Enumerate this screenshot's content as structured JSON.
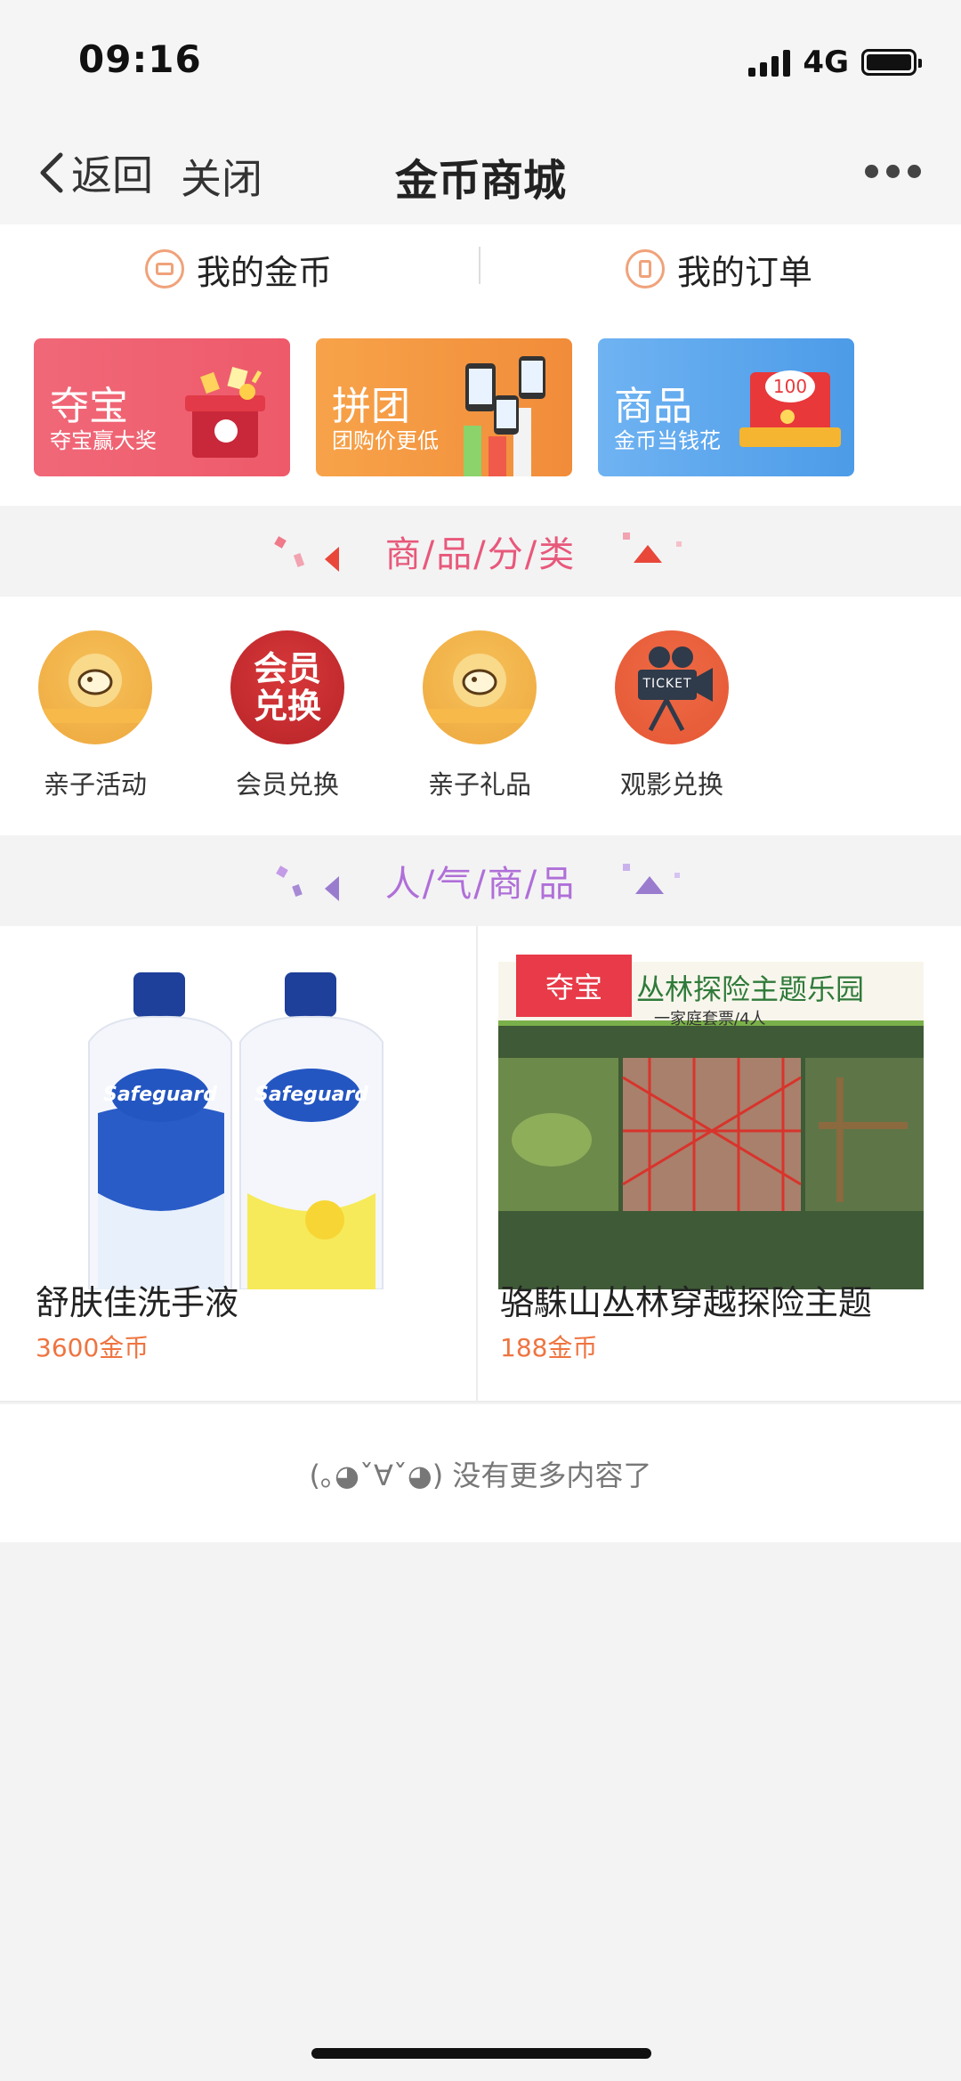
{
  "status_bar": {
    "time": "09:16",
    "network": "4G"
  },
  "nav": {
    "back_label": "返回",
    "close_label": "关闭",
    "title": "金币商城"
  },
  "tabs": {
    "my_coins": "我的金币",
    "my_orders": "我的订单"
  },
  "banners": [
    {
      "title": "夺宝",
      "subtitle": "夺宝赢大奖",
      "color": "#ee5a6a"
    },
    {
      "title": "拼团",
      "subtitle": "团购价更低",
      "color": "#f18c3a"
    },
    {
      "title": "商品",
      "subtitle": "金币当钱花",
      "color": "#4c9be8"
    }
  ],
  "sections": {
    "categories_title": "商/品/分/类",
    "popular_title": "人/气/商/品"
  },
  "categories": [
    {
      "label": "亲子活动"
    },
    {
      "label": "会员兑换",
      "icon_text": "会员兑换"
    },
    {
      "label": "亲子礼品"
    },
    {
      "label": "观影兑换",
      "icon_text": "TICKET"
    }
  ],
  "products": [
    {
      "name": "舒肤佳洗手液",
      "price": "3600金币"
    },
    {
      "name": "骆駯山丛林穿越探险主题",
      "price": "188金币",
      "badge": "夺宝",
      "banner_title": "丛林探险主题乐园",
      "banner_subtitle": "一家庭套票/4人"
    }
  ],
  "footer": {
    "no_more_text": "(｡◕ˇ∀ˇ◕) 没有更多内容了"
  },
  "colors": {
    "price": "#ef7440",
    "category_title": "#e8587a",
    "popular_title": "#b06fd8"
  }
}
